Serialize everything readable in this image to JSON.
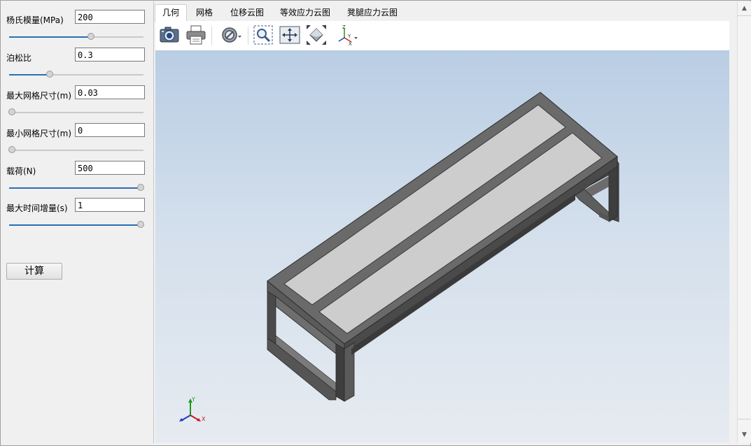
{
  "params": [
    {
      "label": "杨氏模量(MPa)",
      "value": "200",
      "slider": 0.61
    },
    {
      "label": "泊松比",
      "value": "0.3",
      "slider": 0.3
    },
    {
      "label": "最大网格尺寸(m)",
      "value": "0.03",
      "slider": 0.02
    },
    {
      "label": "最小网格尺寸(m)",
      "value": "0",
      "slider": 0.0
    },
    {
      "label": "载荷(N)",
      "value": "500",
      "slider": 1.0
    },
    {
      "label": "最大时间增量(s)",
      "value": "1",
      "slider": 1.0
    }
  ],
  "calc_button": "计算",
  "tabs": [
    {
      "label": "几何",
      "active": true
    },
    {
      "label": "网格",
      "active": false
    },
    {
      "label": "位移云图",
      "active": false
    },
    {
      "label": "等效应力云图",
      "active": false
    },
    {
      "label": "凳腿应力云图",
      "active": false
    }
  ],
  "toolbar": [
    "camera-icon",
    "print-icon",
    "hide-icon",
    "zoom-window-icon",
    "pan-icon",
    "fit-all-icon",
    "view-axes-icon"
  ],
  "axis_labels": {
    "x": "X",
    "y": "Y",
    "z": "Z"
  },
  "colors": {
    "accent": "#2a6eb5",
    "frame": "#5a5a5a",
    "slat": "#cfcfcf"
  }
}
